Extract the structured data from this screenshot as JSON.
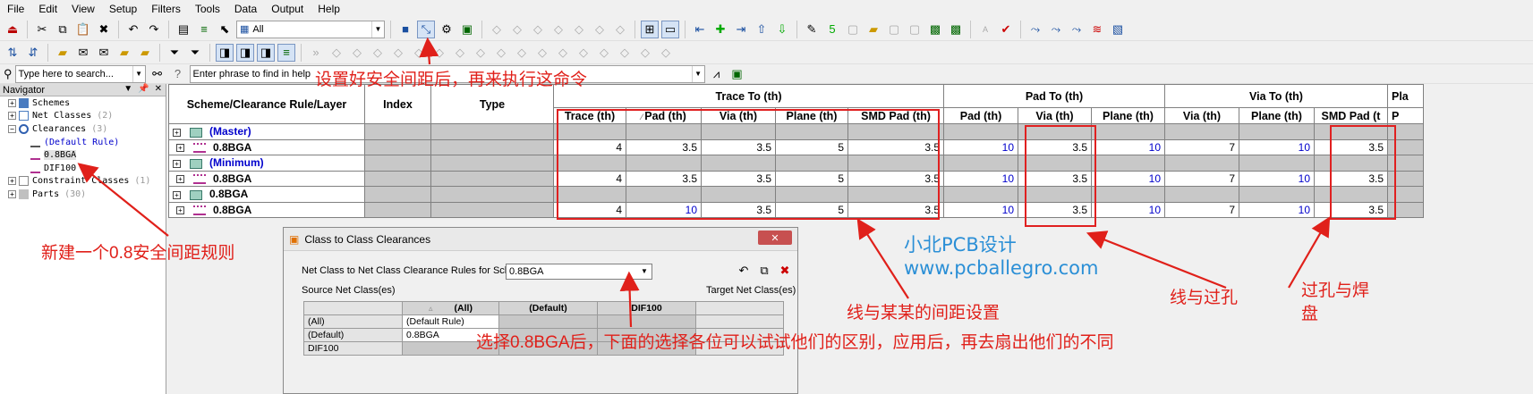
{
  "menu": [
    "File",
    "Edit",
    "View",
    "Setup",
    "Filters",
    "Tools",
    "Data",
    "Output",
    "Help"
  ],
  "toolbar": {
    "filter_combo": "All",
    "search_placeholder": "Type here to search...",
    "phrase_placeholder": "Enter phrase to find in help"
  },
  "navigator": {
    "title": "Navigator",
    "items": [
      {
        "label": "Schemes",
        "count": ""
      },
      {
        "label": "Net Classes",
        "count": "(2)"
      },
      {
        "label": "Clearances",
        "count": "(3)"
      },
      {
        "label": "(Default Rule)",
        "count": ""
      },
      {
        "label": "0.8BGA",
        "count": ""
      },
      {
        "label": "DIF100",
        "count": ""
      },
      {
        "label": "Constraint Classes",
        "count": "(1)"
      },
      {
        "label": "Parts",
        "count": "(30)"
      }
    ]
  },
  "grid": {
    "group_headers": [
      "Trace To (th)",
      "Pad To (th)",
      "Via To (th)",
      "Pla"
    ],
    "fixed_headers": [
      "Scheme/Clearance Rule/Layer",
      "Index",
      "Type"
    ],
    "sub_headers": [
      "Trace (th)",
      "Pad (th)",
      "Via (th)",
      "Plane (th)",
      "SMD Pad (th)",
      "Pad (th)",
      "Via (th)",
      "Plane (th)",
      "Via (th)",
      "Plane (th)",
      "SMD Pad (t",
      "P"
    ],
    "rows": [
      {
        "name": "(Master)",
        "kind": "scheme-blue"
      },
      {
        "name": "0.8BGA",
        "kind": "rule",
        "values": [
          "4",
          "3.5",
          "3.5",
          "5",
          "3.5",
          "10",
          "3.5",
          "10",
          "7",
          "10",
          "3.5"
        ]
      },
      {
        "name": "(Minimum)",
        "kind": "scheme-blue"
      },
      {
        "name": "0.8BGA",
        "kind": "rule",
        "values": [
          "4",
          "3.5",
          "3.5",
          "5",
          "3.5",
          "10",
          "3.5",
          "10",
          "7",
          "10",
          "3.5"
        ]
      },
      {
        "name": "0.8BGA",
        "kind": "scheme"
      },
      {
        "name": "0.8BGA",
        "kind": "rule",
        "values": [
          "4",
          "10",
          "3.5",
          "5",
          "3.5",
          "10",
          "3.5",
          "10",
          "7",
          "10",
          "3.5"
        ]
      }
    ]
  },
  "dialog": {
    "title": "Class to Class Clearances",
    "scheme_label": "Net Class to Net Class Clearance Rules for Scheme:",
    "scheme_value": "0.8BGA",
    "source_label": "Source Net Class(es)",
    "target_label": "Target Net Class(es)",
    "col_headers": [
      "(All)",
      "(Default)",
      "DIF100"
    ],
    "row_headers": [
      "(All)",
      "(Default)",
      "DIF100"
    ],
    "cells": [
      "(Default Rule)",
      "0.8BGA"
    ]
  },
  "annotations": {
    "top": "设置好安全间距后，再来执行这命令",
    "left": "新建一个0.8安全间距规则",
    "brand": "小北PCB设计",
    "url": "www.pcballegro.com",
    "trace_note": "线与某某的间距设置",
    "dialog_note": "选择0.8BGA后，下面的选择各位可以试试他们的区别，应用后，再去扇出他们的不同",
    "via_note": "线与过孔",
    "pad_note_1": "过孔与焊",
    "pad_note_2": "盘"
  }
}
